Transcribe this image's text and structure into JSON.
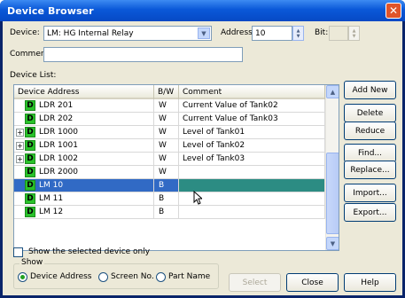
{
  "window": {
    "title": "Device Browser"
  },
  "device": {
    "label": "Device:",
    "value": "LM: HG Internal Relay"
  },
  "address": {
    "label": "Address:",
    "value": "10"
  },
  "bit": {
    "label": "Bit:",
    "value": ""
  },
  "comment": {
    "label": "Comment:",
    "value": ""
  },
  "device_list": {
    "label": "Device List:",
    "columns": {
      "address": "Device Address",
      "bw": "B/W",
      "comment": "Comment"
    },
    "rows": [
      {
        "expand": "",
        "badge": "D",
        "address": "LDR 201",
        "bw": "W",
        "comment": "Current Value of Tank02",
        "selected": false
      },
      {
        "expand": "",
        "badge": "D",
        "address": "LDR 202",
        "bw": "W",
        "comment": "Current Value of Tank03",
        "selected": false
      },
      {
        "expand": "+",
        "badge": "D",
        "address": "LDR 1000",
        "bw": "W",
        "comment": "Level of Tank01",
        "selected": false
      },
      {
        "expand": "+",
        "badge": "D",
        "address": "LDR 1001",
        "bw": "W",
        "comment": "Level of Tank02",
        "selected": false
      },
      {
        "expand": "+",
        "badge": "D",
        "address": "LDR 1002",
        "bw": "W",
        "comment": "Level of Tank03",
        "selected": false
      },
      {
        "expand": "",
        "badge": "D",
        "address": "LDR 2000",
        "bw": "W",
        "comment": "",
        "selected": false
      },
      {
        "expand": "",
        "badge": "D",
        "address": "LM 10",
        "bw": "B",
        "comment": "",
        "selected": true
      },
      {
        "expand": "",
        "badge": "D",
        "address": "LM 11",
        "bw": "B",
        "comment": "",
        "selected": false
      },
      {
        "expand": "",
        "badge": "D",
        "address": "LM 12",
        "bw": "B",
        "comment": "",
        "selected": false
      }
    ]
  },
  "buttons": {
    "add_new": "Add New",
    "delete": "Delete",
    "reduce": "Reduce",
    "find": "Find...",
    "replace": "Replace...",
    "import": "Import...",
    "export": "Export...",
    "select": "Select",
    "close": "Close",
    "help": "Help"
  },
  "show_selected_only": {
    "label": "Show the selected device only",
    "checked": false
  },
  "show_group": {
    "label": "Show",
    "options": [
      {
        "label": "Device Address",
        "selected": true
      },
      {
        "label": "Screen No.",
        "selected": false
      },
      {
        "label": "Part Name",
        "selected": false
      }
    ]
  },
  "colors": {
    "title_bar": "#0a58d8",
    "selection": "#316ac5",
    "comment_edit": "#2c8c83",
    "device_badge": "#29c12a"
  },
  "icons": [
    "close-icon",
    "dropdown-arrow-icon",
    "spin-up-icon",
    "spin-down-icon",
    "device-d-icon",
    "expand-plus-icon",
    "scroll-up-icon",
    "scroll-down-icon",
    "mouse-cursor-icon"
  ]
}
